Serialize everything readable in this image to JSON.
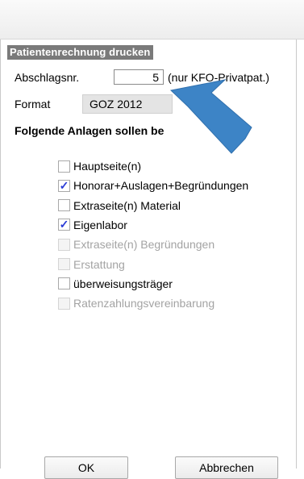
{
  "dialog": {
    "group_label": "Patientenrechnung drucken",
    "abschlag_label": "Abschlagsnr.",
    "abschlag_value": "5",
    "abschlag_hint": "(nur KFO-Privatpat.)",
    "format_label": "Format",
    "format_value": "GOZ 2012",
    "anlagen_title": "Folgende Anlagen sollen be",
    "checkboxes": [
      {
        "label": "Hauptseite(n)",
        "checked": false,
        "enabled": true
      },
      {
        "label": "Honorar+Auslagen+Begründungen",
        "checked": true,
        "enabled": true
      },
      {
        "label": "Extraseite(n) Material",
        "checked": false,
        "enabled": true
      },
      {
        "label": "Eigenlabor",
        "checked": true,
        "enabled": true
      },
      {
        "label": "Extraseite(n) Begründungen",
        "checked": false,
        "enabled": false
      },
      {
        "label": "Erstattung",
        "checked": false,
        "enabled": false
      },
      {
        "label": "überweisungsträger",
        "checked": false,
        "enabled": true
      },
      {
        "label": "Ratenzahlungsvereinbarung",
        "checked": false,
        "enabled": false
      }
    ],
    "ok_label": "OK",
    "cancel_label": "Abbrechen"
  },
  "colors": {
    "group_label_bg": "#7a7a7a",
    "checkmark": "#2a3bd6",
    "arrow": "#3d84c6"
  },
  "icons": {
    "checkmark": "check-icon",
    "annotation": "pointer-arrow-icon"
  }
}
